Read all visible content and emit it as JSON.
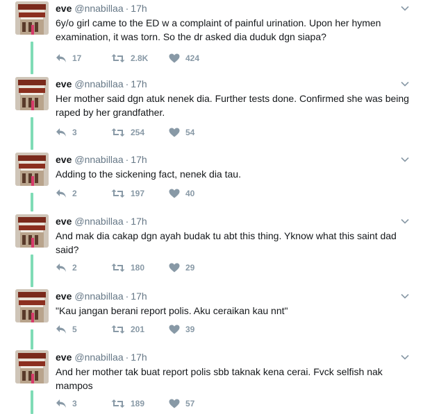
{
  "tweets": [
    {
      "name": "eve",
      "handle": "@nnabillaa",
      "time": "17h",
      "text": "6y/o girl came to the ED w a complaint of painful urination. Upon her hymen examination, it was torn. So the dr asked dia duduk dgn siapa?",
      "replies": "17",
      "retweets": "2.8K",
      "likes": "424"
    },
    {
      "name": "eve",
      "handle": "@nnabillaa",
      "time": "17h",
      "text": "Her mother said dgn atuk nenek dia. Further tests done. Confirmed she was being raped by her grandfather.",
      "replies": "3",
      "retweets": "254",
      "likes": "54"
    },
    {
      "name": "eve",
      "handle": "@nnabillaa",
      "time": "17h",
      "text": "Adding to the sickening fact, nenek dia tau.",
      "replies": "2",
      "retweets": "197",
      "likes": "40"
    },
    {
      "name": "eve",
      "handle": "@nnabillaa",
      "time": "17h",
      "text": "And mak dia cakap dgn ayah budak tu abt this thing. Yknow what this saint dad said?",
      "replies": "2",
      "retweets": "180",
      "likes": "29"
    },
    {
      "name": "eve",
      "handle": "@nnabillaa",
      "time": "17h",
      "text": "\"Kau jangan berani report polis. Aku ceraikan kau nnt\"",
      "replies": "5",
      "retweets": "201",
      "likes": "39"
    },
    {
      "name": "eve",
      "handle": "@nnabillaa",
      "time": "17h",
      "text": "And her mother tak buat report polis sbb taknak kena cerai. Fvck selfish nak mampos",
      "replies": "3",
      "retweets": "189",
      "likes": "57"
    }
  ],
  "separator": "·",
  "colors": {
    "thread_line": "#7fdcb6",
    "meta": "#657786",
    "action": "#8899a6"
  }
}
